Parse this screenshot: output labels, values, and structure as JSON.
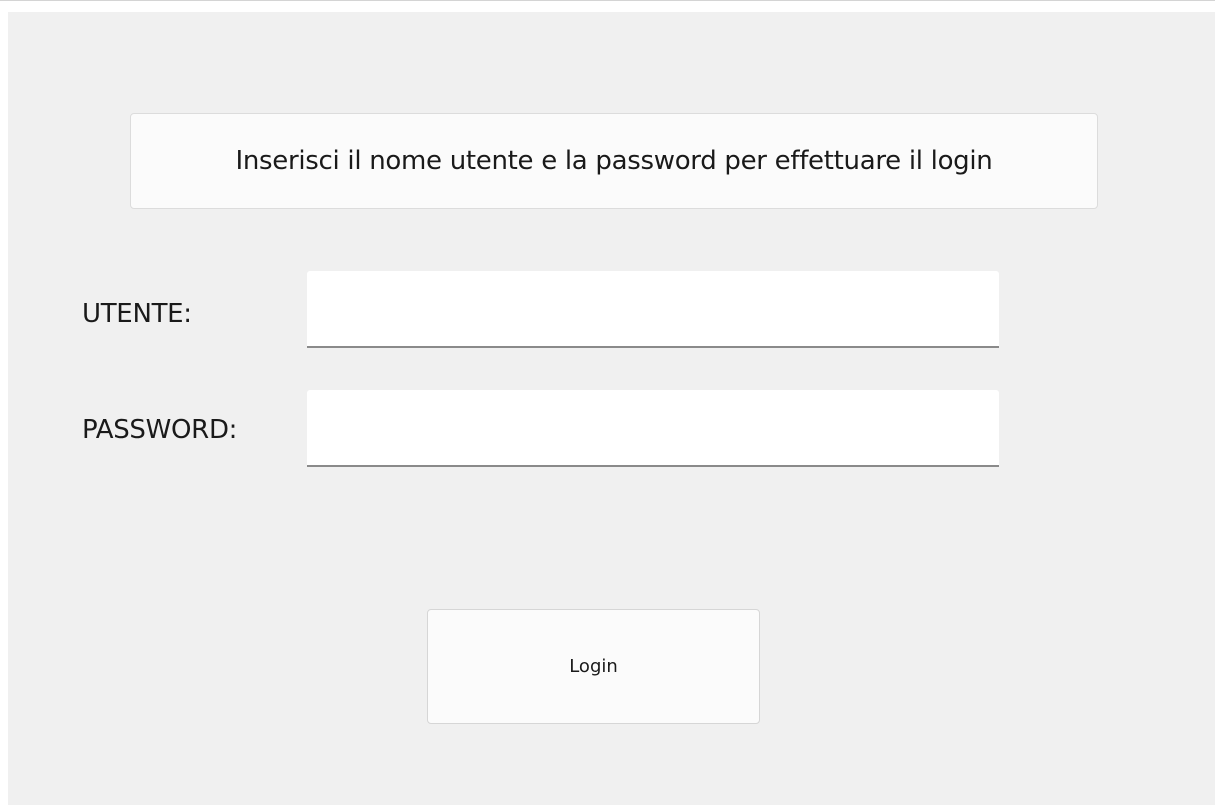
{
  "banner": {
    "text": "Inserisci il nome utente e la password per effettuare il login"
  },
  "form": {
    "user_label": "UTENTE:",
    "user_value": "",
    "password_label": "PASSWORD:",
    "password_value": ""
  },
  "login_button": {
    "label": "Login"
  },
  "colors": {
    "window_background": "#f0f0f0",
    "card_background": "#fbfbfb",
    "input_background": "#ffffff",
    "input_underline": "#8a8a8a"
  }
}
